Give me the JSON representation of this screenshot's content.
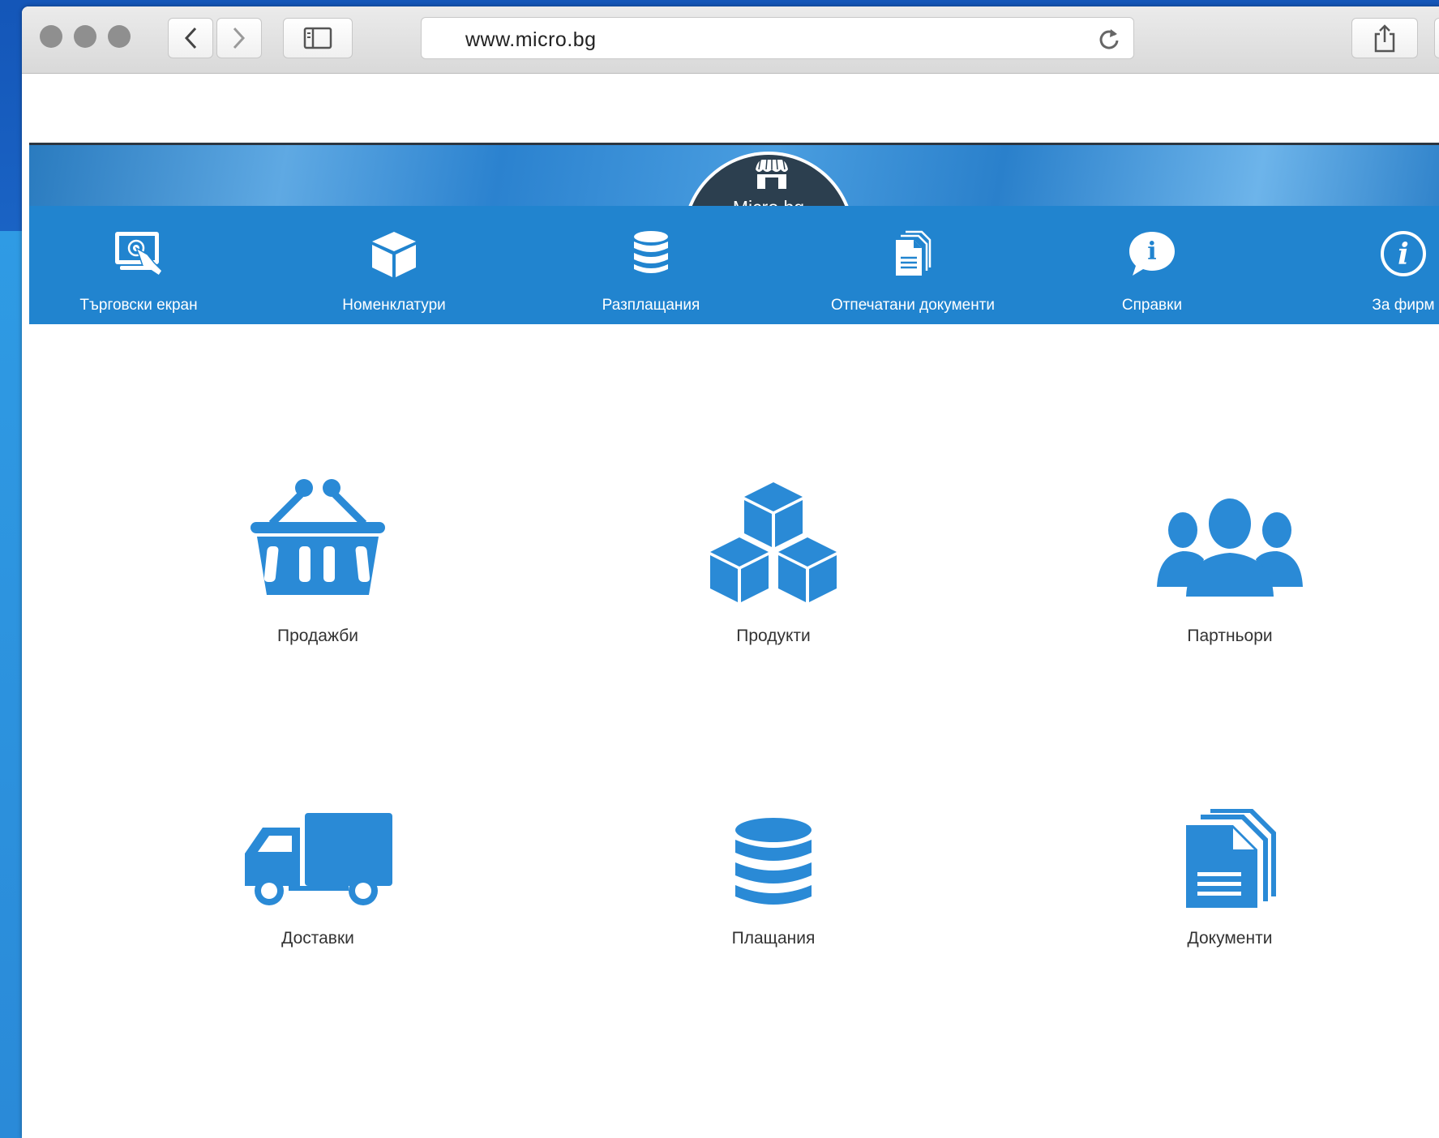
{
  "browser": {
    "url": "www.micro.bg"
  },
  "site": {
    "logo_text": "Micro.bg",
    "nav": [
      {
        "label": "Търговски екран",
        "icon": "touch-screen-icon"
      },
      {
        "label": "Номенклатури",
        "icon": "box-icon"
      },
      {
        "label": "Разплащания",
        "icon": "database-icon"
      },
      {
        "label": "Отпечатани документи",
        "icon": "documents-icon"
      },
      {
        "label": "Справки",
        "icon": "info-bubble-icon"
      },
      {
        "label": "За фирм",
        "icon": "info-circle-icon"
      }
    ],
    "tiles": [
      {
        "label": "Продажби",
        "icon": "basket-icon"
      },
      {
        "label": "Продукти",
        "icon": "cubes-icon"
      },
      {
        "label": "Партньори",
        "icon": "users-icon"
      },
      {
        "label": "Доставки",
        "icon": "truck-icon"
      },
      {
        "label": "Плащания",
        "icon": "database-icon"
      },
      {
        "label": "Документи",
        "icon": "documents-icon"
      }
    ]
  },
  "colors": {
    "accent": "#2184cf",
    "icon": "#2a8ad6",
    "logo_bg": "#2c3f4f"
  }
}
